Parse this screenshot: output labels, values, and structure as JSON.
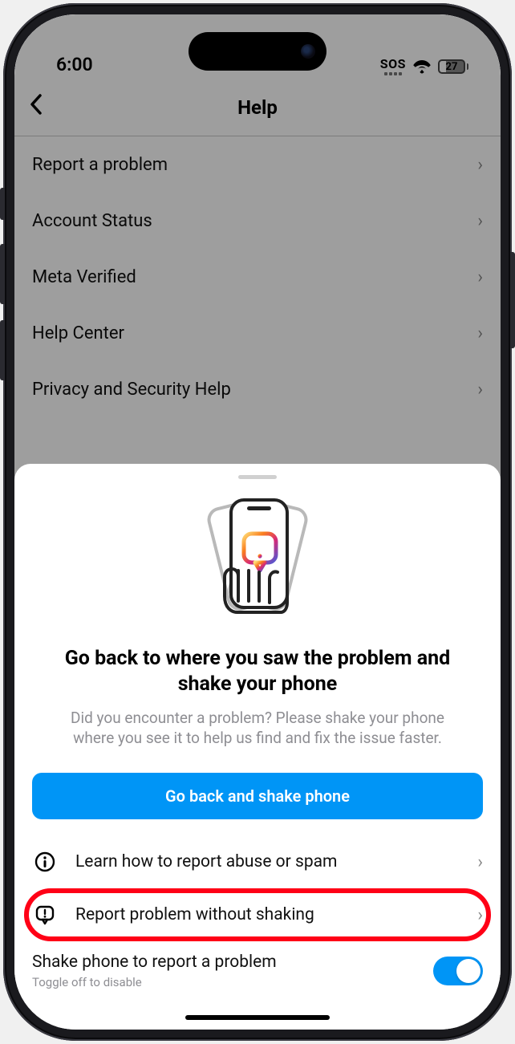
{
  "status": {
    "time": "6:00",
    "sos": "SOS",
    "battery_pct": "27"
  },
  "header": {
    "title": "Help"
  },
  "menu": {
    "items": [
      {
        "label": "Report a problem"
      },
      {
        "label": "Account Status"
      },
      {
        "label": "Meta Verified"
      },
      {
        "label": "Help Center"
      },
      {
        "label": "Privacy and Security Help"
      }
    ]
  },
  "sheet": {
    "title": "Go back to where you saw the problem and shake your phone",
    "subtitle": "Did you encounter a problem? Please shake your phone where you see it to help us find and fix the issue faster.",
    "primary_button": "Go back and shake phone",
    "rows": [
      {
        "label": "Learn how to report abuse or spam"
      },
      {
        "label": "Report problem without shaking"
      }
    ],
    "toggle": {
      "label": "Shake phone to report a problem",
      "hint": "Toggle off to disable",
      "on": true
    }
  },
  "colors": {
    "accent": "#0095f6",
    "highlight": "#ff0016"
  }
}
